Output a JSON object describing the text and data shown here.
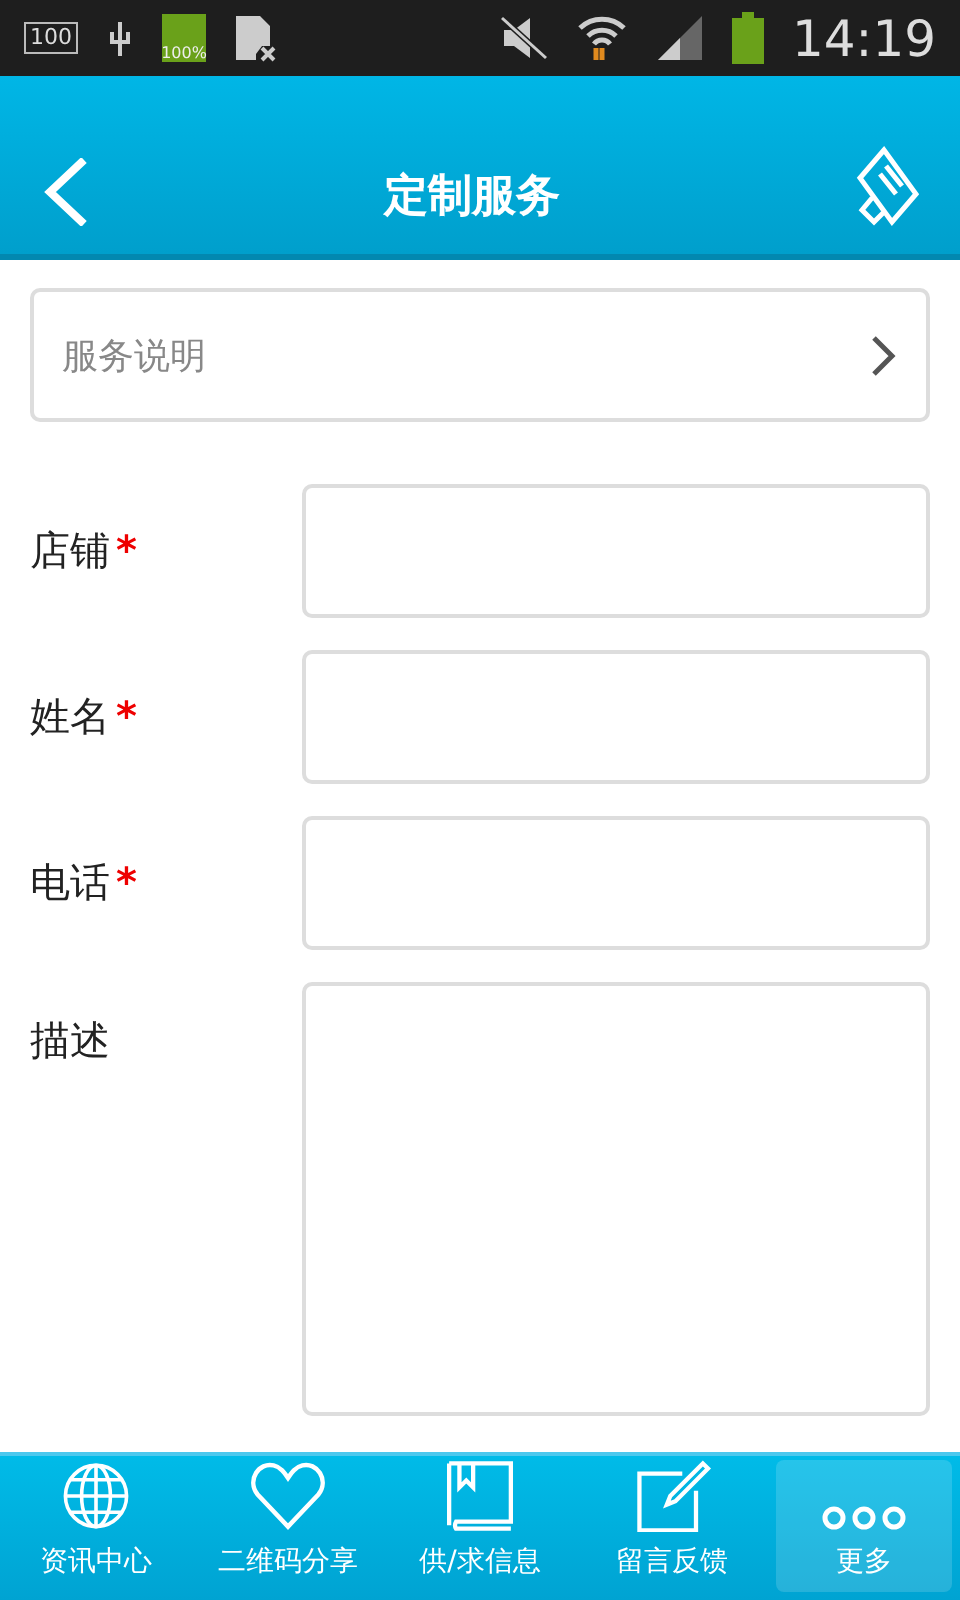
{
  "status_bar": {
    "storage": "100",
    "battery_small": "100%",
    "time": "14:19"
  },
  "header": {
    "title": "定制服务"
  },
  "service_row": {
    "label": "服务说明"
  },
  "form": [
    {
      "label": "店铺",
      "required": true,
      "kind": "line"
    },
    {
      "label": "姓名",
      "required": true,
      "kind": "line"
    },
    {
      "label": "电话",
      "required": true,
      "kind": "line"
    },
    {
      "label": "描述",
      "required": false,
      "kind": "area"
    }
  ],
  "required_mark": "*",
  "tabs": [
    {
      "label": "资讯中心",
      "kind": "globe",
      "selected": false
    },
    {
      "label": "二维码分享",
      "kind": "heart",
      "selected": false
    },
    {
      "label": "供/求信息",
      "kind": "book",
      "selected": false
    },
    {
      "label": "留言反馈",
      "kind": "edit",
      "selected": false
    },
    {
      "label": "更多",
      "kind": "dots",
      "selected": true
    }
  ]
}
